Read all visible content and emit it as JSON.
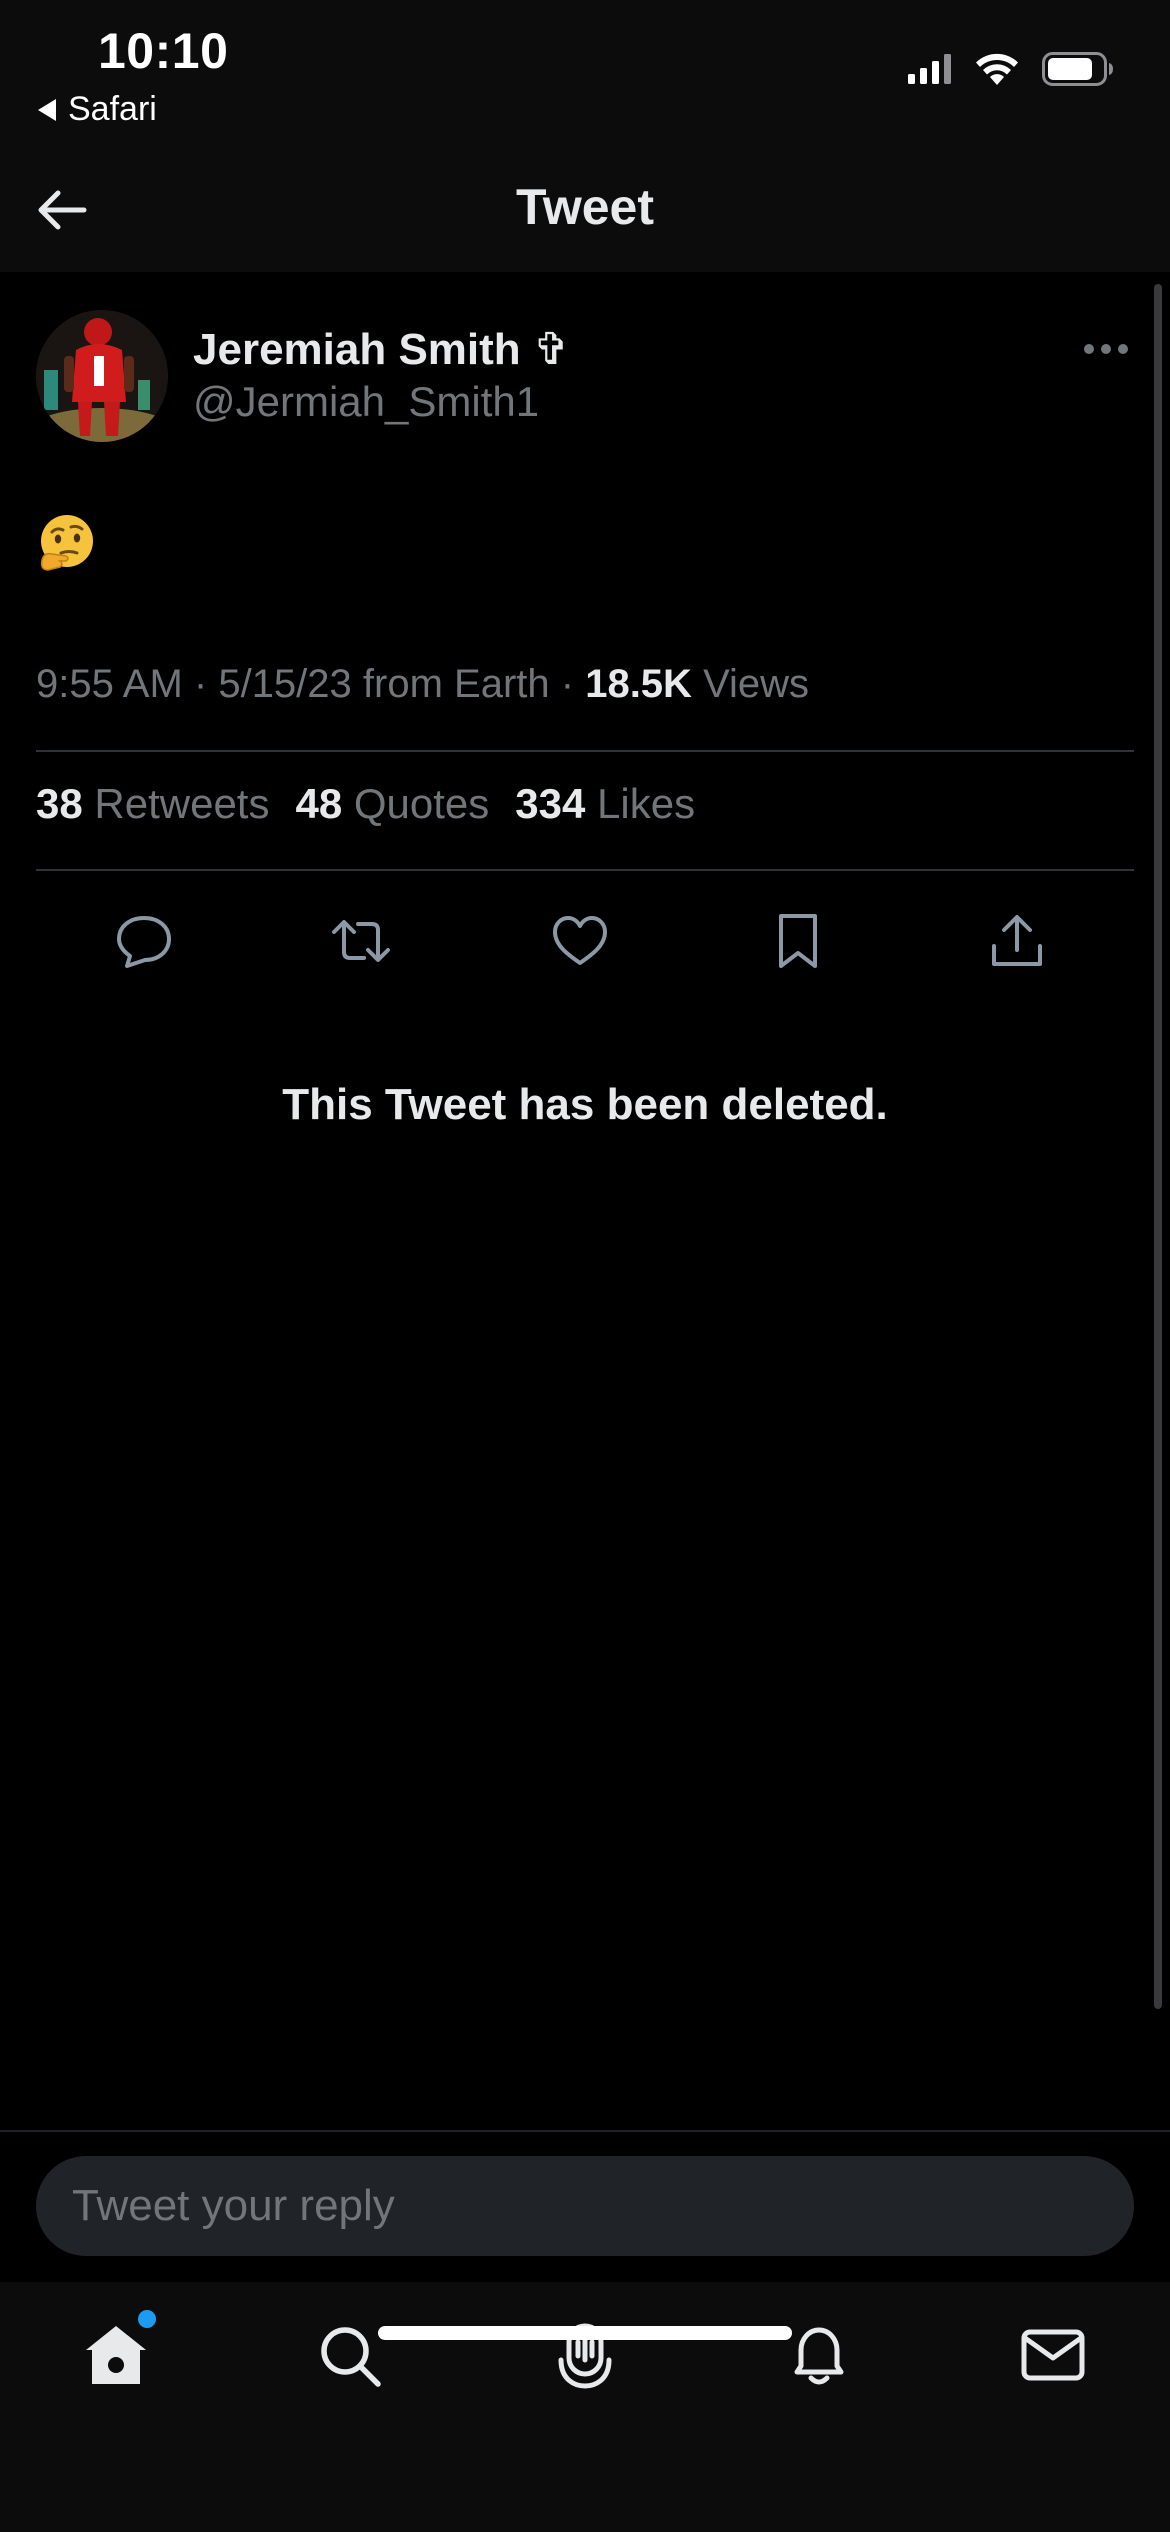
{
  "status_bar": {
    "time": "10:10",
    "back_app": "Safari"
  },
  "header": {
    "title": "Tweet"
  },
  "tweet": {
    "author_name": "Jeremiah Smith ✞",
    "author_handle": "@Jermiah_Smith1",
    "body_emoji": "thinking-face",
    "time": "9:55 AM",
    "date": "5/15/23",
    "source": "from Earth",
    "views_count": "18.5K",
    "views_label": "Views",
    "retweets_count": "38",
    "retweets_label": "Retweets",
    "quotes_count": "48",
    "quotes_label": "Quotes",
    "likes_count": "334",
    "likes_label": "Likes"
  },
  "actions": [
    "reply-icon",
    "retweet-icon",
    "like-icon",
    "bookmark-icon",
    "share-icon"
  ],
  "notice": {
    "deleted_text": "This Tweet has been deleted."
  },
  "reply": {
    "placeholder": "Tweet your reply"
  },
  "tab_bar": {
    "items": [
      "home-icon",
      "search-icon",
      "spaces-icon",
      "notifications-icon",
      "messages-icon"
    ],
    "home_has_notification": true
  },
  "colors": {
    "background": "#000000",
    "bar_background": "#0c0c0d",
    "primary_text": "#e7e9ea",
    "secondary_text": "#71767b",
    "divider": "#2f3336",
    "accent_blue": "#1d9bf0"
  }
}
